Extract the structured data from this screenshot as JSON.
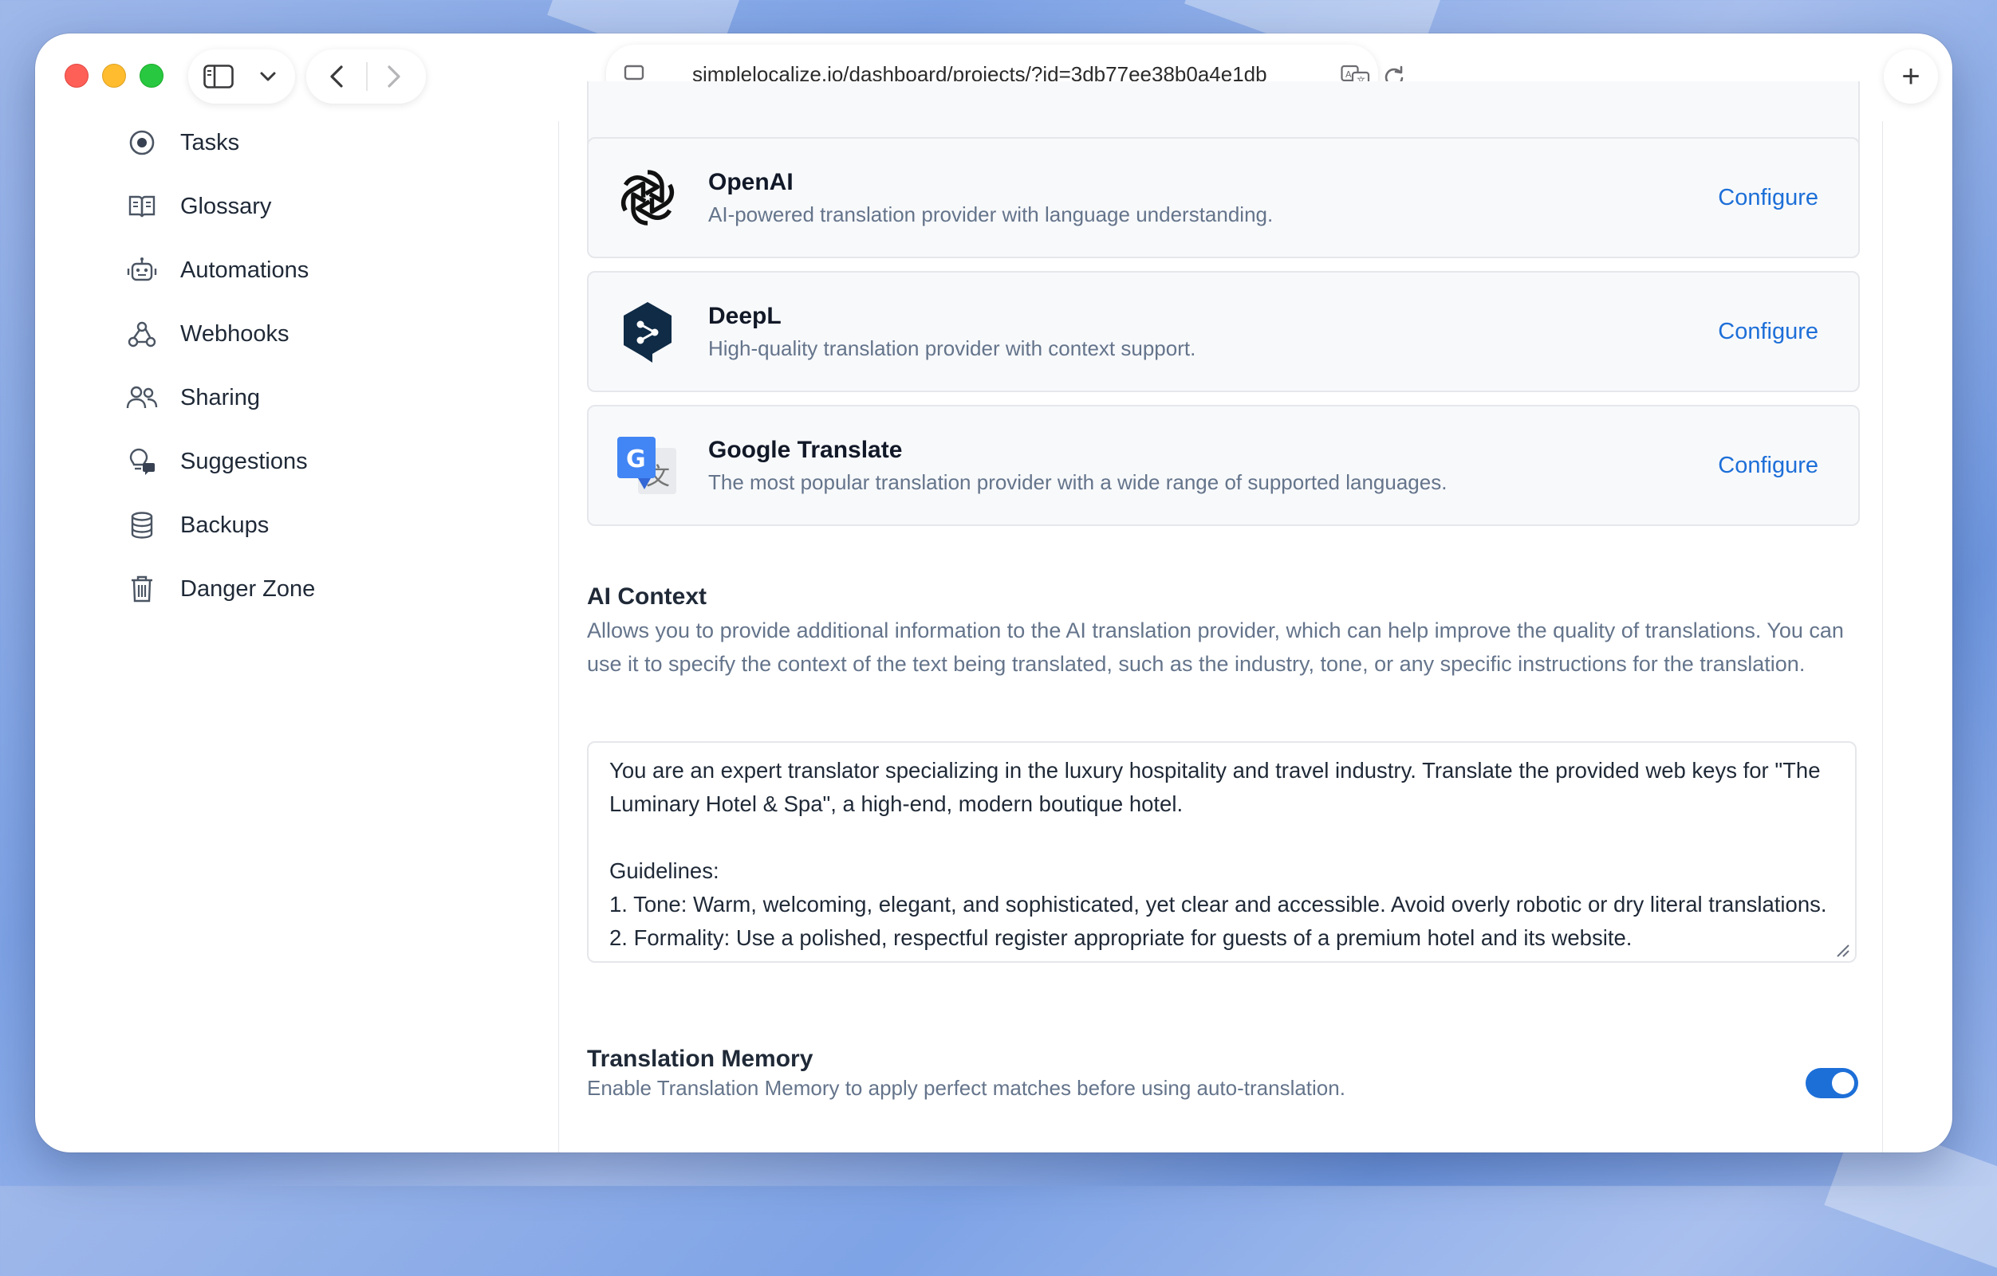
{
  "browser": {
    "url": "simplelocalize.io/dashboard/projects/?id=3db77ee38b0a4e1db",
    "new_tab_symbol": "+"
  },
  "sidebar": {
    "items": [
      {
        "label": "Tasks",
        "icon": "target-icon"
      },
      {
        "label": "Glossary",
        "icon": "book-icon"
      },
      {
        "label": "Automations",
        "icon": "robot-icon"
      },
      {
        "label": "Webhooks",
        "icon": "webhook-icon"
      },
      {
        "label": "Sharing",
        "icon": "users-icon"
      },
      {
        "label": "Suggestions",
        "icon": "bulb-chat-icon"
      },
      {
        "label": "Backups",
        "icon": "database-icon"
      },
      {
        "label": "Danger Zone",
        "icon": "trash-icon"
      }
    ]
  },
  "providers": [
    {
      "name": "OpenAI",
      "description": "AI-powered translation provider with language understanding.",
      "action": "Configure"
    },
    {
      "name": "DeepL",
      "description": "High-quality translation provider with context support.",
      "action": "Configure"
    },
    {
      "name": "Google Translate",
      "description": "The most popular translation provider with a wide range of supported languages.",
      "action": "Configure"
    }
  ],
  "ai_context": {
    "title": "AI Context",
    "description": "Allows you to provide additional information to the AI translation provider, which can help improve the quality of translations. You can use it to specify the context of the text being translated, such as the industry, tone, or any specific instructions for the translation.",
    "value": "You are an expert translator specializing in the luxury hospitality and travel industry. Translate the provided web keys for \"The Luminary Hotel & Spa\", a high-end, modern boutique hotel.\n\nGuidelines:\n1. Tone: Warm, welcoming, elegant, and sophisticated, yet clear and accessible. Avoid overly robotic or dry literal translations.\n2. Formality: Use a polished, respectful register appropriate for guests of a premium hotel and its website."
  },
  "translation_memory": {
    "title": "Translation Memory",
    "description": "Enable Translation Memory to apply perfect matches before using auto-translation.",
    "enabled": true
  },
  "colors": {
    "accent": "#1d6fd8",
    "muted_text": "#64748b",
    "card_bg": "#f8f9fb",
    "deepl_navy": "#0f2b46",
    "google_blue": "#4285f4"
  }
}
